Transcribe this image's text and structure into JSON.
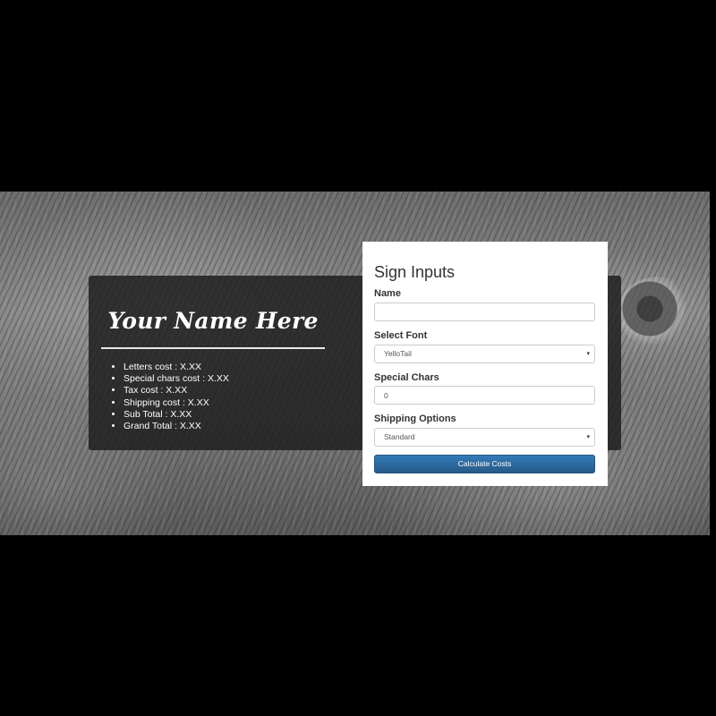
{
  "preview": {
    "sign_text": "Your Name Here",
    "costs": [
      "Letters cost : X.XX",
      "Special chars cost : X.XX",
      "Tax cost : X.XX",
      "Shipping cost : X.XX",
      "Sub Total : X.XX",
      "Grand Total : X.XX"
    ]
  },
  "form": {
    "title": "Sign Inputs",
    "name_label": "Name",
    "name_value": "",
    "font_label": "Select Font",
    "font_selected": "YelloTail",
    "special_label": "Special Chars",
    "special_value": "0",
    "shipping_label": "Shipping Options",
    "shipping_selected": "Standard",
    "submit_label": "Calculate Costs",
    "select_caret": "▾"
  },
  "colors": {
    "button": "#337ab7",
    "background": "#000000"
  }
}
